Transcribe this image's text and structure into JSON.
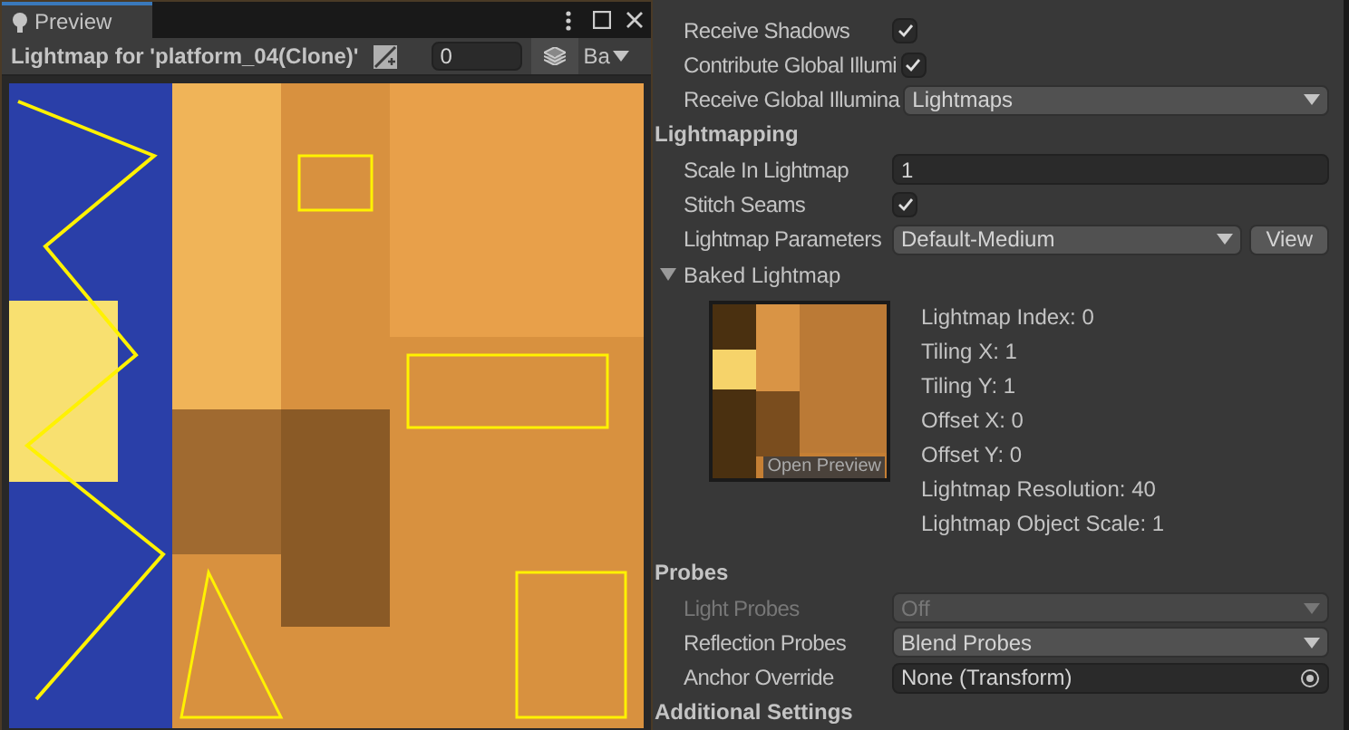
{
  "preview": {
    "tab": {
      "label": "Preview",
      "selected": true
    },
    "title": "Lightmap for 'platform_04(Clone)'",
    "index_field": "0",
    "channel_dropdown": "Ba"
  },
  "inspector": {
    "rows": [
      {
        "kind": "checkbox",
        "label": "Receive Shadows",
        "checked": true
      },
      {
        "kind": "checkbox",
        "label": "Contribute Global Illumi",
        "checked": true
      },
      {
        "kind": "dropdown",
        "label": "Receive Global Illumina",
        "value": "Lightmaps",
        "disabled": false
      },
      {
        "kind": "header",
        "label": "Lightmapping"
      },
      {
        "kind": "field",
        "label": "Scale In Lightmap",
        "value": "1"
      },
      {
        "kind": "checkbox",
        "label": "Stitch Seams",
        "checked": true
      },
      {
        "kind": "dropdown-button",
        "label": "Lightmap Parameters",
        "value": "Default-Medium",
        "button": "View"
      },
      {
        "kind": "foldout",
        "label": "Baked Lightmap",
        "expanded": true,
        "open_preview": "Open Preview",
        "info": [
          "Lightmap Index: 0",
          "Tiling X: 1",
          "Tiling Y: 1",
          "Offset X: 0",
          "Offset Y: 0",
          "Lightmap Resolution: 40",
          "Lightmap Object Scale: 1"
        ]
      },
      {
        "kind": "header",
        "label": "Probes"
      },
      {
        "kind": "dropdown",
        "label": "Light Probes",
        "value": "Off",
        "disabled": true
      },
      {
        "kind": "dropdown",
        "label": "Reflection Probes",
        "value": "Blend Probes",
        "disabled": false
      },
      {
        "kind": "object",
        "label": "Anchor Override",
        "value": "None (Transform)"
      },
      {
        "kind": "header",
        "label": "Additional Settings"
      }
    ]
  }
}
